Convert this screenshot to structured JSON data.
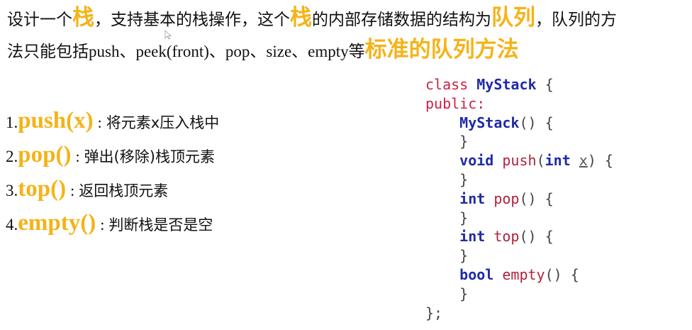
{
  "intro": {
    "line1_a": "设计一个",
    "line1_hl1": "栈",
    "line1_b": "，支持基本的栈操作，这个",
    "line1_hl2": "栈",
    "line1_c": "的内部存储数据的结构为",
    "line1_hl3": "队列",
    "line1_d": "，队列的方",
    "line2_a": "法只能包括",
    "line2_latin": "push、peek(front)、pop、size、empty",
    "line2_b": "等",
    "line2_hl": "标准的队列方法"
  },
  "methods": [
    {
      "num": "1.",
      "name": "push(x)",
      "desc": "将元素x压入栈中"
    },
    {
      "num": "2.",
      "name": "pop()",
      "desc": "弹出(移除)栈顶元素"
    },
    {
      "num": "3.",
      "name": "top()",
      "desc": "返回栈顶元素"
    },
    {
      "num": "4.",
      "name": "empty()",
      "desc": "判断栈是否是空"
    }
  ],
  "colon": ":",
  "code": {
    "class_kw": "class",
    "class_name": "MyStack",
    "open_brace": "{",
    "public_kw": "public:",
    "ctor": "MyStack",
    "parens": "()",
    "close_brace": "}",
    "void_kw": "void",
    "push_fn": "push",
    "int_kw": "int",
    "param_x": "x",
    "pop_fn": "pop",
    "top_fn": "top",
    "bool_kw": "bool",
    "empty_fn": "empty",
    "end": "};"
  },
  "colors": {
    "highlight": "#f5b318",
    "keyword_blue": "#1f2aa8",
    "keyword_red": "#cc2244"
  }
}
